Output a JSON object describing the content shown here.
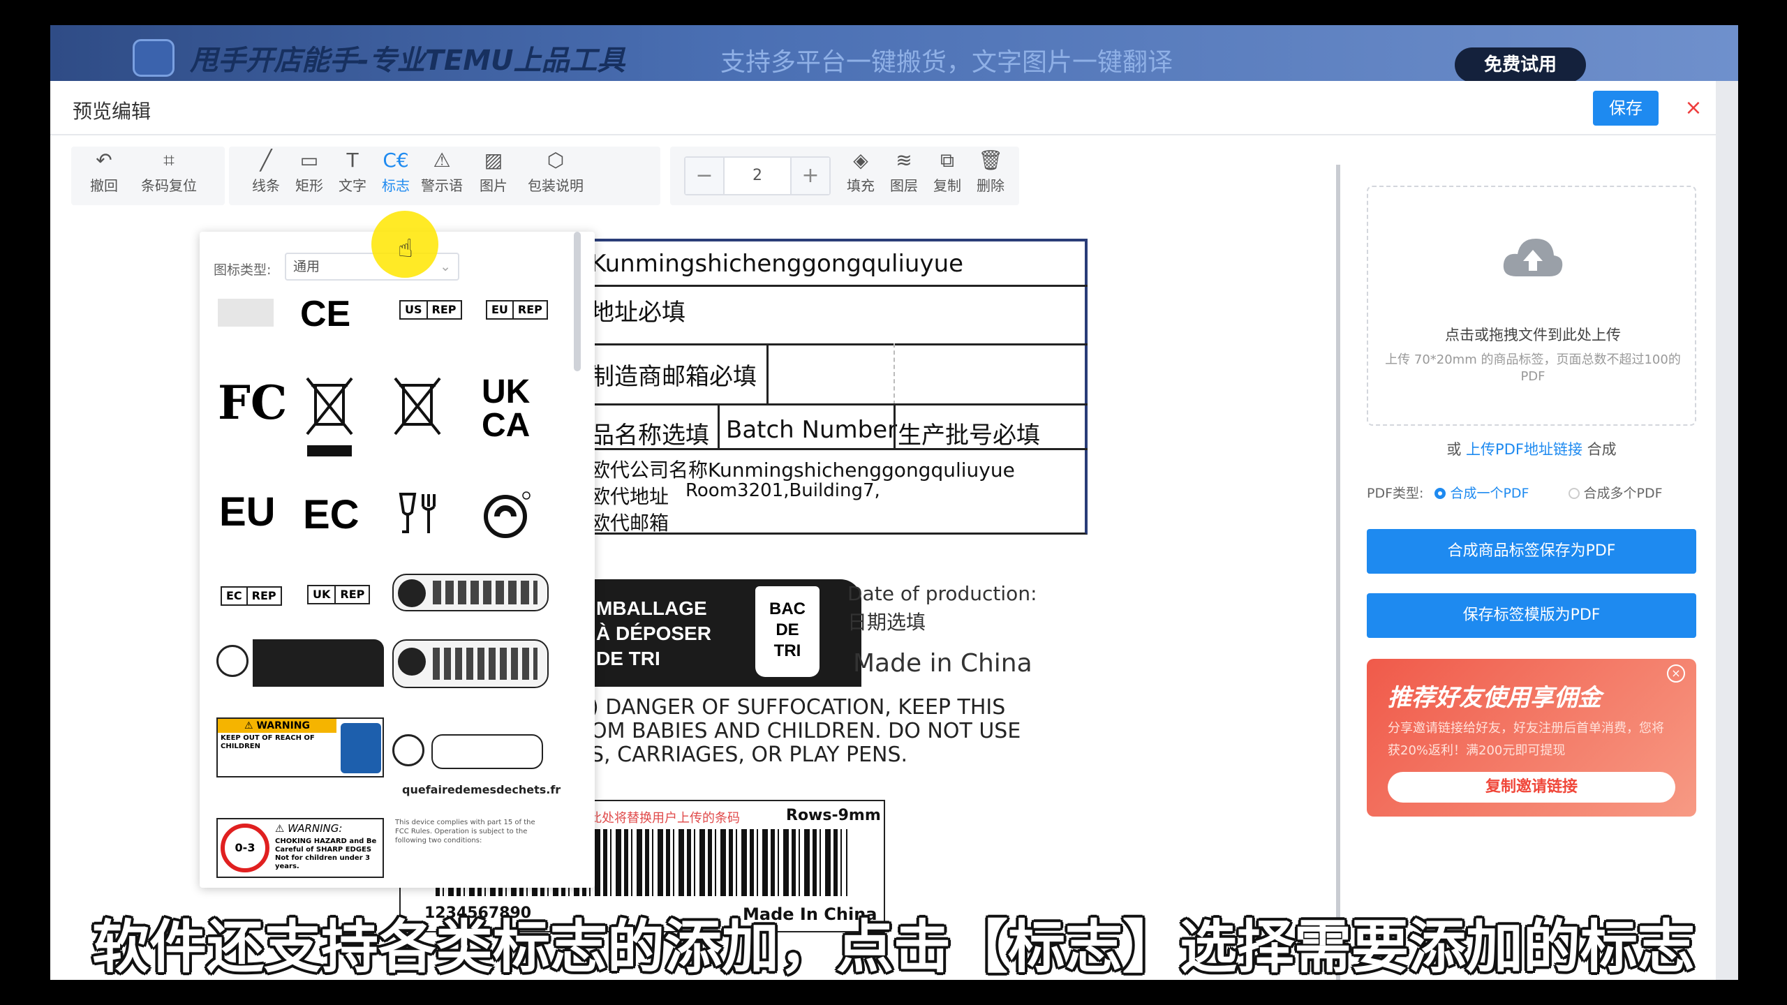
{
  "banner": {
    "title": "甩手开店能手-专业TEMU上品工具",
    "slogan": "支持多平台一键搬货，文字图片一键翻译",
    "trial_button": "免费试用"
  },
  "dialog": {
    "title": "预览编辑",
    "save_label": "保存",
    "close_label": "×"
  },
  "toolbar": {
    "undo": "撤回",
    "barcode_reset": "条码复位",
    "line": "线条",
    "rect": "矩形",
    "text": "文字",
    "logo": "标志",
    "warning": "警示语",
    "image": "图片",
    "package": "包装说明",
    "stepper_value": "2",
    "stepper_minus": "−",
    "stepper_plus": "+",
    "fill": "填充",
    "layer": "图层",
    "copy": "复制",
    "delete": "删除"
  },
  "logo_panel": {
    "type_label": "图标类型:",
    "type_value": "通用",
    "symbols": {
      "ce": "CE",
      "us_rep": [
        "US",
        "REP"
      ],
      "eu_rep": [
        "EU",
        "REP"
      ],
      "fc": "FC",
      "ukca_top": "UK",
      "ukca_bottom": "CA",
      "eu": "EU",
      "ec": "EC",
      "ec_rep": [
        "EC",
        "REP"
      ],
      "uk_rep": [
        "UK",
        "REP"
      ],
      "triman_site": "quefairedemesdechets.fr",
      "warning_title": "WARNING",
      "warning_body": "KEEP OUT OF REACH OF CHILDREN",
      "choking_title": "WARNING:",
      "choking_body": "CHOKING HAZARD and Be Careful of SHARP EDGES Not for children under 3 years.",
      "choking_age": "0-3",
      "fcc_text": "This device complies with part 15 of the FCC Rules. Operation is subject to the following two conditions:"
    }
  },
  "label": {
    "company": "Kunmingshichenggongquliuyue",
    "address_required": "地址必填",
    "email_required": "制造商邮箱必填",
    "product_name": "品名称选填",
    "batch_number": "Batch Number",
    "batch_required": "生产批号必填",
    "agent_company": "欧代公司名称Kunmingshichenggongquliuyue",
    "agent_address": "欧代地址",
    "agent_address_value": "Room3201,Building7,",
    "agent_email": "欧代邮箱",
    "recycle_line1": "MBALLAGE",
    "recycle_line2": "À DÉPOSER",
    "recycle_line3": "DE TRI",
    "bin_text": [
      "BAC",
      "DE",
      "TRI"
    ],
    "date_of_production": "Date of production:",
    "date_optional": "日期选填",
    "made_in_china": "Made In China",
    "made_in_china_title": "Made in China",
    "warning_line1": ") DANGER OF SUFFOCATION, KEEP THIS",
    "warning_line2": "OM BABIES AND CHILDREN. DO NOT USE",
    "warning_line3": "S, CARRIAGES, OR PLAY PENS.",
    "barcode_hint": "此处将替换用户上传的条码",
    "rows": "Rows-9mm",
    "barcode_number": "1234567890"
  },
  "sidebar": {
    "upload_title": "点击或拖拽文件到此处上传",
    "upload_hint": "上传 70*20mm 的商品标签，页面总数不超过100的PDF",
    "or_prefix": "或",
    "or_link": "上传PDF地址链接",
    "or_suffix": "合成",
    "pdf_type_label": "PDF类型:",
    "pdf_option1": "合成一个PDF",
    "pdf_option2": "合成多个PDF",
    "button1": "合成商品标签保存为PDF",
    "button2": "保存标签模版为PDF",
    "promo_title": "推荐好友使用享佣金",
    "promo_desc": "分享邀请链接给好友，好友注册后首单消费，您将获20%返利！满200元即可提现",
    "promo_button": "复制邀请链接",
    "promo_close": "×"
  },
  "subtitle": "软件还支持各类标志的添加，点击【标志】选择需要添加的标志",
  "colors": {
    "accent": "#1e8af0",
    "close_red": "#ee3c3c",
    "promo": "#f05a4a"
  }
}
